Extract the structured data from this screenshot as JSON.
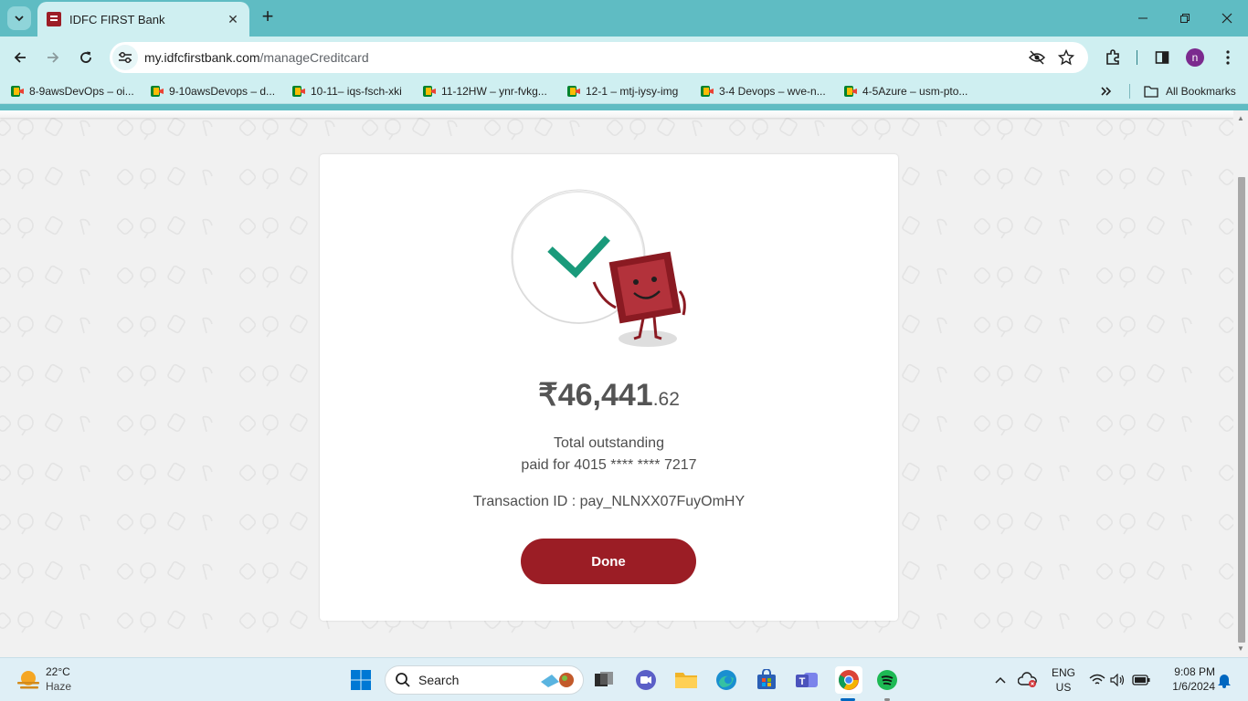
{
  "browser": {
    "tab_title": "IDFC FIRST Bank",
    "url_host": "my.idfcfirstbank.com",
    "url_path": "/manageCreditcard",
    "profile_initial": "n",
    "bookmarks": [
      "8-9awsDevOps – oi...",
      "9-10awsDevops – d...",
      "10-11– iqs-fsch-xki",
      "11-12HW – ynr-fvkg...",
      "12-1 – mtj-iysy-img",
      "3-4 Devops – wve-n...",
      "4-5Azure – usm-pto..."
    ],
    "more_bookmarks_icon": "chevron-double-right-icon",
    "all_bookmarks_label": "All Bookmarks"
  },
  "payment": {
    "amount_whole": "₹46,441",
    "amount_decimal": ".62",
    "status_line1": "Total outstanding",
    "status_line2": "paid for 4015 **** **** 7217",
    "transaction": "Transaction ID : pay_NLNXX07FuyOmHY",
    "done_label": "Done"
  },
  "taskbar": {
    "weather_temp": "22°C",
    "weather_desc": "Haze",
    "search_placeholder": "Search",
    "lang_line1": "ENG",
    "lang_line2": "US",
    "time": "9:08 PM",
    "date": "1/6/2024"
  },
  "colors": {
    "brand": "#9b1d25",
    "check": "#1a9a7b",
    "browser_frame": "#5fbcc3",
    "toolbar": "#cfeff1"
  }
}
